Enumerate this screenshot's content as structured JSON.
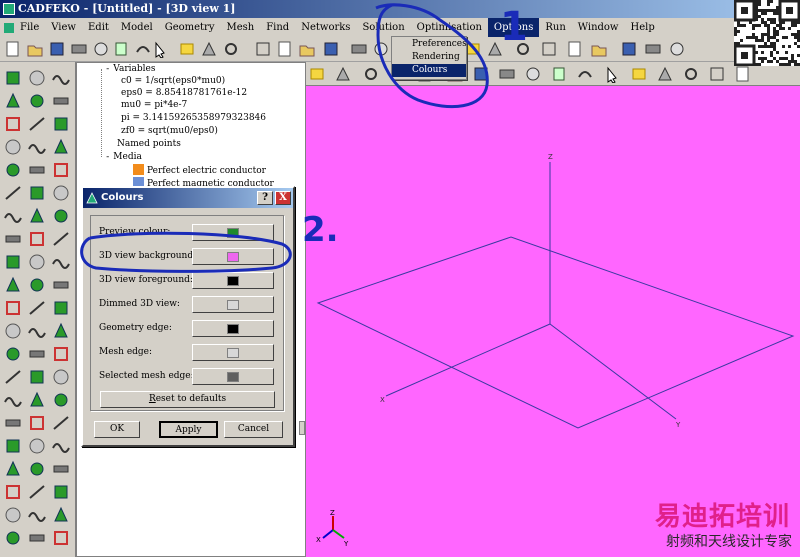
{
  "window": {
    "title": "CADFEKO - [Untitled] - [3D view 1]"
  },
  "menu": {
    "items": [
      "File",
      "View",
      "Edit",
      "Model",
      "Geometry",
      "Mesh",
      "Find",
      "Networks",
      "Solution",
      "Optimisation",
      "Options",
      "Run",
      "Window",
      "Help"
    ],
    "active": "Options"
  },
  "options_menu": {
    "items": [
      "Preferences",
      "Rendering",
      "Colours"
    ],
    "highlighted": "Colours"
  },
  "tree": {
    "variables_label": "Variables",
    "variables": [
      "c0 = 1/sqrt(eps0*mu0)",
      "eps0 = 8.85418781761e-12",
      "mu0 = pi*4e-7",
      "pi = 3.14159265358979323846",
      "zf0 = sqrt(mu0/eps0)"
    ],
    "named_points_label": "Named points",
    "media_label": "Media",
    "media": [
      {
        "name": "Perfect electric conductor",
        "color": "#f28c1c"
      },
      {
        "name": "Perfect magnetic conductor",
        "color": "#6b8fd6"
      }
    ]
  },
  "dialog": {
    "title": "Colours",
    "rows": [
      {
        "label": "Preview colour:",
        "color": "#1f8a2c"
      },
      {
        "label": "3D view background:",
        "color": "#ee66ee"
      },
      {
        "label": "3D view foreground:",
        "color": "#000000"
      },
      {
        "label": "Dimmed 3D view:",
        "color": "#d8d8d8"
      },
      {
        "label": "Geometry edge:",
        "color": "#000000"
      },
      {
        "label": "Mesh edge:",
        "color": "#d8d8d8"
      },
      {
        "label": "Selected mesh edge:",
        "color": "#606060"
      }
    ],
    "reset_label": "Reset to defaults",
    "ok_label": "OK",
    "apply_label": "Apply",
    "cancel_label": "Cancel",
    "help_label": "?",
    "close_label": "X"
  },
  "viewport": {
    "background": "#ff66ff",
    "axis_x": "X",
    "axis_y": "Y",
    "axis_z": "Z"
  },
  "annotations": {
    "step1": "1",
    "step2": "2."
  },
  "watermark": {
    "line1": "易迪拓培训",
    "line2": "射频和天线设计专家"
  },
  "colors": {
    "annotation": "#1a2bb8",
    "titlebar": "#0a246a"
  }
}
